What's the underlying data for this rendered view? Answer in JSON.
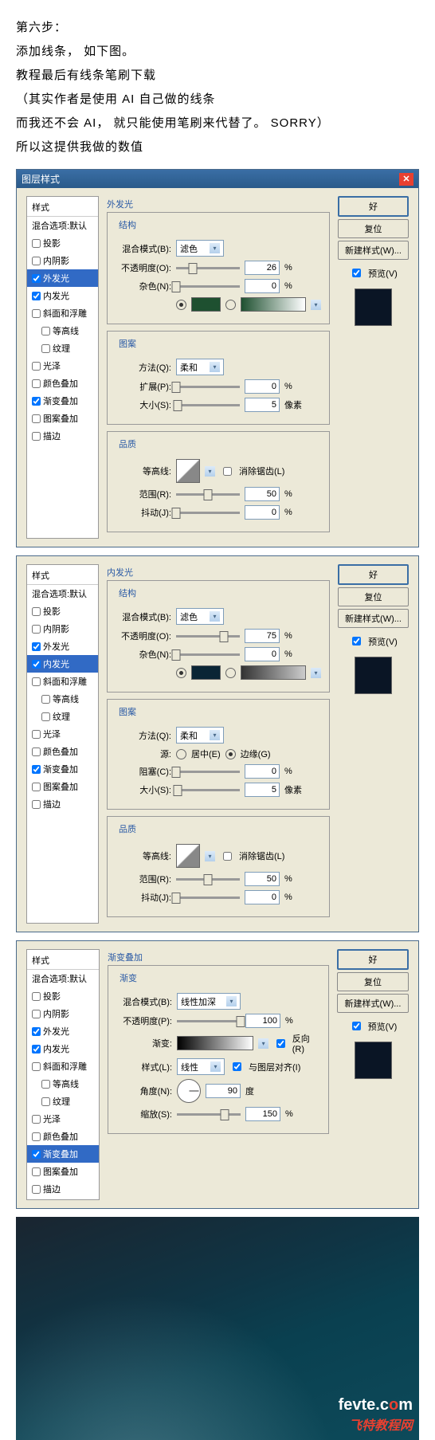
{
  "tutorial": {
    "line1": "第六步：",
    "line2": "添加线条，  如下图。",
    "line3": "教程最后有线条笔刷下载",
    "line4": "（其实作者是使用 AI 自己做的线条",
    "line5": "而我还不会 AI，  就只能使用笔刷来代替了。  SORRY）",
    "line6": "所以这提供我做的数值"
  },
  "dialogTitle": "图层样式",
  "styles": {
    "header": "样式",
    "blendDefault": "混合选项:默认",
    "dropShadow": "投影",
    "innerShadow": "内阴影",
    "outerGlow": "外发光",
    "innerGlow": "内发光",
    "bevelEmboss": "斜面和浮雕",
    "contour": "等高线",
    "texture": "纹理",
    "satin": "光泽",
    "colorOverlay": "颜色叠加",
    "gradientOverlay": "渐变叠加",
    "patternOverlay": "图案叠加",
    "stroke": "描边"
  },
  "buttons": {
    "ok": "好",
    "reset": "复位",
    "newStyle": "新建样式(W)...",
    "preview": "预览(V)"
  },
  "labels": {
    "structure": "结构",
    "elements": "图案",
    "quality": "品质",
    "gradient": "渐变",
    "blendMode": "混合模式(B):",
    "opacity": "不透明度(O):",
    "noise": "杂色(N):",
    "technique": "方法(Q):",
    "spread": "扩展(P):",
    "size": "大小(S):",
    "choke": "阻塞(C):",
    "source": "源:",
    "center": "居中(E)",
    "edge": "边缘(G)",
    "contourL": "等高线:",
    "antiAlias": "消除锯齿(L)",
    "range": "范围(R):",
    "jitter": "抖动(J):",
    "gradientL": "渐变:",
    "reverse": "反向(R)",
    "style": "样式(L):",
    "alignLayer": "与图层对齐(I)",
    "angle": "角度(N):",
    "degree": "度",
    "scale": "缩放(S):",
    "px": "像素",
    "pct": "%",
    "opacityP": "不透明度(P):"
  },
  "values": {
    "screen": "滤色",
    "soft": "柔和",
    "linear": "线性",
    "linearDodge": "线性加深"
  },
  "d1": {
    "opacity": "26",
    "noise": "0",
    "spread": "0",
    "size": "5",
    "range": "50",
    "jitter": "0",
    "glowColor": "#1e5030"
  },
  "d2": {
    "opacity": "75",
    "noise": "0",
    "choke": "0",
    "size": "5",
    "range": "50",
    "jitter": "0",
    "glowColor": "#0a2535"
  },
  "d3": {
    "opacity": "100",
    "angle": "90",
    "scale": "150"
  },
  "watermark": {
    "line1a": "fevte",
    "line1b": ".c",
    "line1c": "m",
    "line2": "飞特教程网"
  }
}
